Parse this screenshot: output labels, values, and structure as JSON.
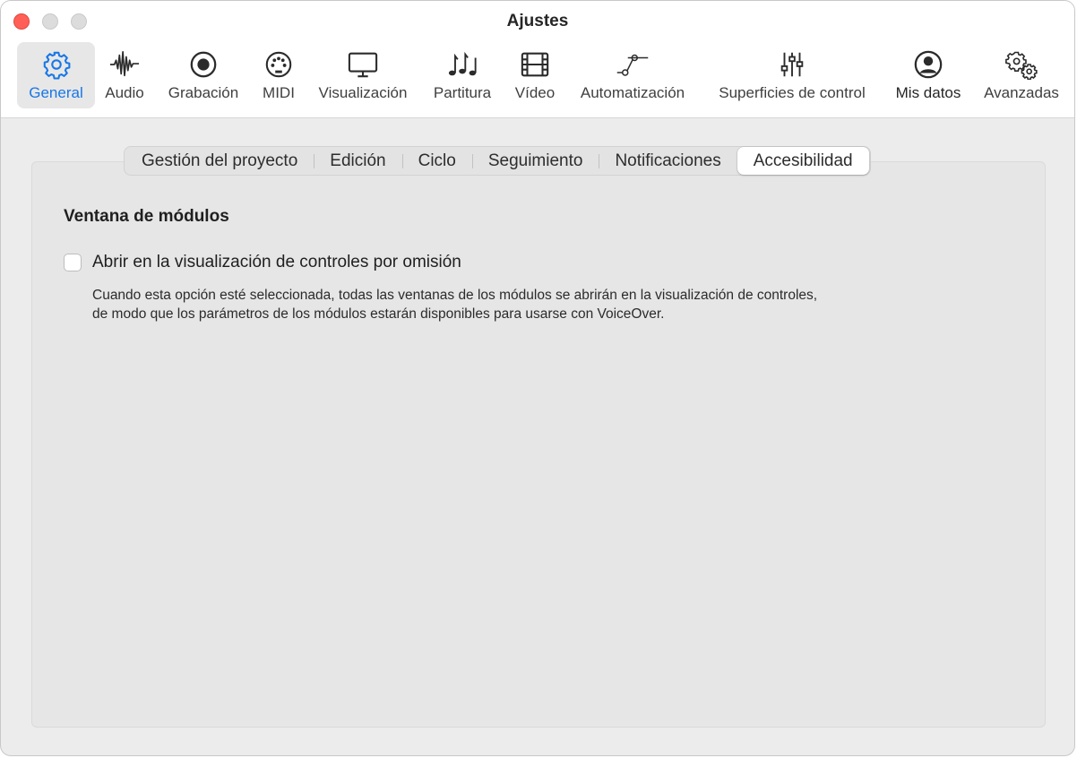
{
  "window": {
    "title": "Ajustes"
  },
  "toolbar": {
    "panes": [
      {
        "label": "General",
        "icon": "gear-icon",
        "active": true
      },
      {
        "label": "Audio",
        "icon": "waveform-icon"
      },
      {
        "label": "Grabación",
        "icon": "record-icon"
      },
      {
        "label": "MIDI",
        "icon": "midi-connector-icon"
      },
      {
        "label": "Visualización",
        "icon": "display-icon"
      },
      {
        "label": "Partitura",
        "icon": "music-notes-icon"
      },
      {
        "label": "Vídeo",
        "icon": "film-icon"
      },
      {
        "label": "Automatización",
        "icon": "automation-curve-icon"
      },
      {
        "label": "Superficies de control",
        "icon": "sliders-icon"
      },
      {
        "label": "Mis datos",
        "icon": "person-circle-icon"
      },
      {
        "label": "Avanzadas",
        "icon": "gears-icon"
      }
    ]
  },
  "tabs": [
    "Gestión del proyecto",
    "Edición",
    "Ciclo",
    "Seguimiento",
    "Notificaciones",
    "Accesibilidad"
  ],
  "selected_tab": "Accesibilidad",
  "section": {
    "title": "Ventana de módulos",
    "checkbox_label": "Abrir en la visualización de controles por omisión",
    "checkbox_checked": false,
    "description_line1": "Cuando esta opción esté seleccionada, todas las ventanas de los módulos se abrirán en la visualización de controles,",
    "description_line2": "de modo que los parámetros de los módulos estarán disponibles para usarse con VoiceOver."
  },
  "colors": {
    "accent": "#1877e6",
    "close": "#ff5f57"
  }
}
